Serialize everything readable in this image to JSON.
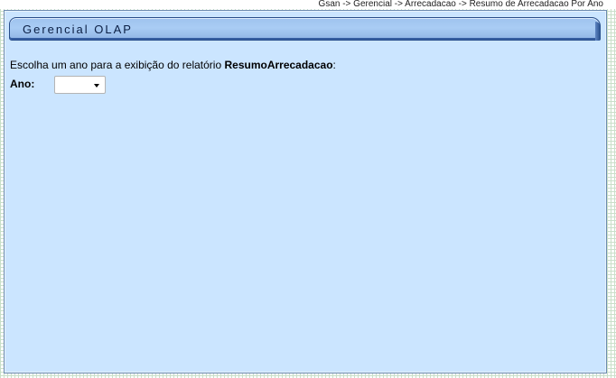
{
  "breadcrumb": {
    "text": "Gsan -> Gerencial -> Arrecadacao -> Resumo de Arrecadacao Por Ano"
  },
  "panel": {
    "title": "Gerencial OLAP"
  },
  "form": {
    "instruction_prefix": "Escolha um ano para a exibição do relatório ",
    "report_name": "ResumoArrecadacao",
    "instruction_suffix": ":",
    "year_label": "Ano:",
    "year_value": ""
  },
  "colors": {
    "panel_background": "#cbe5ff",
    "title_bar": "#a9ccf4",
    "title_border": "#284d8a"
  }
}
